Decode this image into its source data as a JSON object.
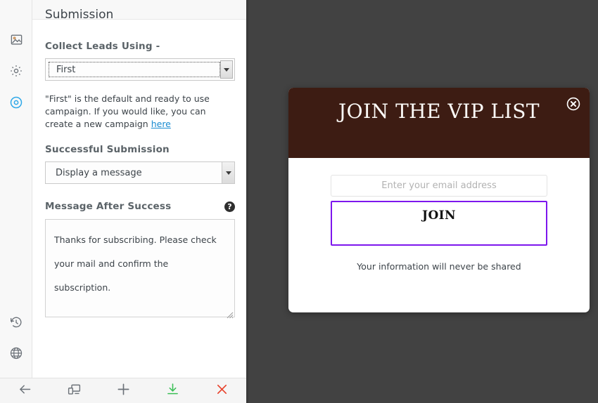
{
  "editor": {
    "panel": {
      "title": "Submission",
      "collect_leads": {
        "label": "Collect Leads Using -",
        "selected": "First",
        "options": [
          "First"
        ]
      },
      "campaign_note": {
        "text_before": "\"First\" is the default and ready to use campaign. If you would like, you can create a new campaign ",
        "link_label": "here"
      },
      "successful_submission": {
        "label": "Successful Submission",
        "selected": "Display a message",
        "options": [
          "Display a message"
        ]
      },
      "message_after_success": {
        "label": "Message After Success",
        "help_badge": "?",
        "value": "Thanks for subscribing. Please check your mail and confirm the subscription."
      }
    },
    "rail_icons": [
      {
        "name": "image-icon",
        "title": "Image"
      },
      {
        "name": "gear-icon",
        "title": "Settings"
      },
      {
        "name": "target-icon",
        "title": "Submission"
      },
      {
        "name": "history-icon",
        "title": "History"
      },
      {
        "name": "globe-icon",
        "title": "Global"
      }
    ],
    "toolbar": [
      {
        "name": "back-icon",
        "title": "Back"
      },
      {
        "name": "devices-icon",
        "title": "Responsive preview"
      },
      {
        "name": "add-icon",
        "title": "Add"
      },
      {
        "name": "save-download-icon",
        "title": "Save"
      },
      {
        "name": "close-icon",
        "title": "Close"
      }
    ]
  },
  "modal": {
    "title": "JOIN THE VIP LIST",
    "close_icon": "close-circle-icon",
    "email_placeholder": "Enter your email address",
    "email_value": "",
    "join_label": "JOIN",
    "footnote": "Your information will never be shared"
  },
  "colors": {
    "modal_header": "#3d1c13",
    "join_border": "#7d16ed",
    "canvas_background": "#424242",
    "link": "#1a8bd0",
    "active_rail_icon": "#2fa8e8",
    "save_icon": "#3bbf56",
    "close_icon": "#e8402a"
  }
}
